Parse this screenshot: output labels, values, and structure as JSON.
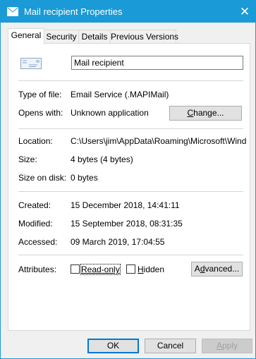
{
  "window": {
    "title": "Mail recipient Properties",
    "close_glyph": "✕"
  },
  "tabs": [
    {
      "label": "General",
      "active": true
    },
    {
      "label": "Security",
      "active": false
    },
    {
      "label": "Details",
      "active": false
    },
    {
      "label": "Previous Versions",
      "active": false
    }
  ],
  "general": {
    "file_name": "Mail recipient",
    "type_label": "Type of file:",
    "type_value": "Email Service (.MAPIMail)",
    "opens_label": "Opens with:",
    "opens_value": "Unknown application",
    "change_button": "Change...",
    "location_label": "Location:",
    "location_value": "C:\\Users\\jim\\AppData\\Roaming\\Microsoft\\Windows\\SendTo",
    "size_label": "Size:",
    "size_value": "4 bytes (4 bytes)",
    "size_disk_label": "Size on disk:",
    "size_disk_value": "0 bytes",
    "created_label": "Created:",
    "created_value": "15 December 2018, 14:41:11",
    "modified_label": "Modified:",
    "modified_value": "15 September 2018, 08:31:35",
    "accessed_label": "Accessed:",
    "accessed_value": "09 March 2019, 17:04:55",
    "attributes_label": "Attributes:",
    "readonly_label": "Read-only",
    "readonly_checked": false,
    "hidden_label": "Hidden",
    "hidden_checked": false,
    "advanced_button": "Advanced..."
  },
  "buttons": {
    "ok": "OK",
    "cancel": "Cancel",
    "apply": "Apply"
  },
  "colors": {
    "titlebar": "#1a9ad6",
    "focus": "#0078d7"
  }
}
